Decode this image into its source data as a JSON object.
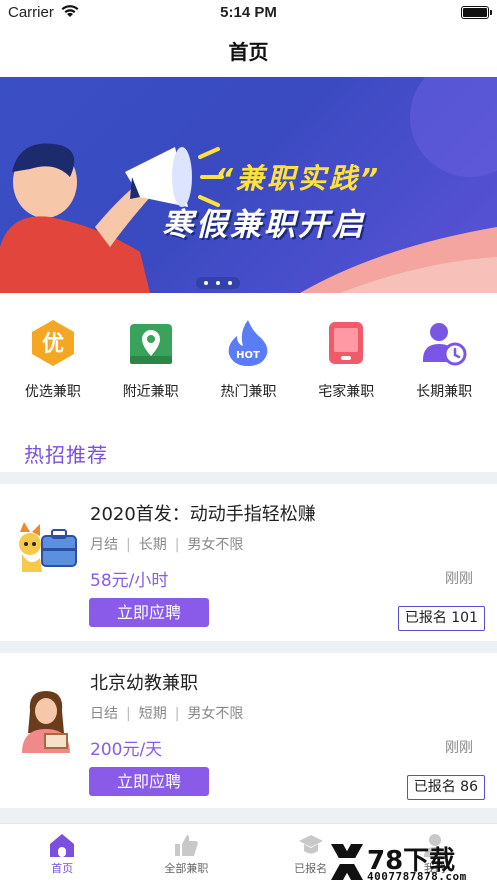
{
  "status": {
    "carrier": "Carrier",
    "time": "5:14 PM"
  },
  "nav": {
    "title": "首页"
  },
  "banner": {
    "headline1": "“兼职实践”",
    "headline2": "寒假兼职开启"
  },
  "categories": [
    {
      "label": "优选兼职",
      "icon": "youxuan-icon",
      "glyph": "优"
    },
    {
      "label": "附近兼职",
      "icon": "location-icon"
    },
    {
      "label": "热门兼职",
      "icon": "hot-flame-icon",
      "glyph": "HOT"
    },
    {
      "label": "宅家兼职",
      "icon": "phone-icon"
    },
    {
      "label": "长期兼职",
      "icon": "user-clock-icon"
    }
  ],
  "section": {
    "title": "热招推荐"
  },
  "jobs": [
    {
      "title": "2020首发：动动手指轻松赚",
      "tags": [
        "月结",
        "长期",
        "男女不限"
      ],
      "pay": "58元/小时",
      "when": "刚刚",
      "apply": "立即应聘",
      "count": "已报名 101"
    },
    {
      "title": "北京幼教兼职",
      "tags": [
        "日结",
        "短期",
        "男女不限"
      ],
      "pay": "200元/天",
      "when": "刚刚",
      "apply": "立即应聘",
      "count": "已报名 86"
    }
  ],
  "tabs": [
    {
      "label": "首页",
      "icon": "home-icon",
      "active": true
    },
    {
      "label": "全部兼职",
      "icon": "thumbs-up-icon",
      "active": false
    },
    {
      "label": "已报名",
      "icon": "graduation-cap-icon",
      "active": false
    },
    {
      "label": "我的",
      "icon": "profile-icon",
      "active": false
    }
  ],
  "watermark": {
    "big": "78下载",
    "small": "4007787878.com"
  },
  "colors": {
    "accent": "#8a5be8",
    "banner_bg": "#3b4fc4",
    "headline_yellow": "#ffe23a"
  }
}
